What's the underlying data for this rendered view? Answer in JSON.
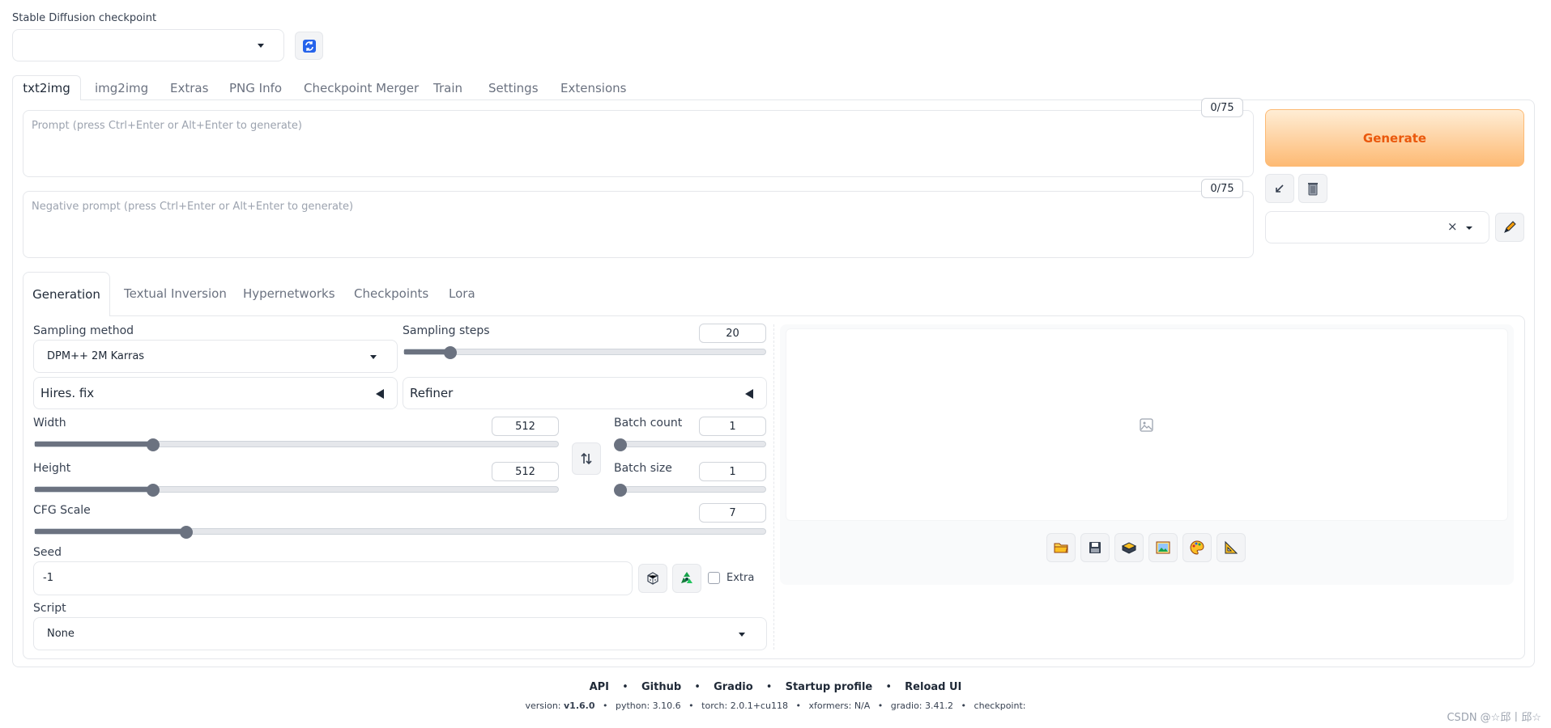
{
  "checkpoint": {
    "label": "Stable Diffusion checkpoint",
    "value": ""
  },
  "top_tabs": [
    "txt2img",
    "img2img",
    "Extras",
    "PNG Info",
    "Checkpoint Merger",
    "Train",
    "Settings",
    "Extensions"
  ],
  "prompt": {
    "placeholder": "Prompt (press Ctrl+Enter or Alt+Enter to generate)",
    "counter": "0/75"
  },
  "negative": {
    "placeholder": "Negative prompt (press Ctrl+Enter or Alt+Enter to generate)",
    "counter": "0/75"
  },
  "generate_label": "Generate",
  "styles": {
    "value": "",
    "clear": "×"
  },
  "sub_tabs": [
    "Generation",
    "Textual Inversion",
    "Hypernetworks",
    "Checkpoints",
    "Lora"
  ],
  "sampling": {
    "label": "Sampling method",
    "value": "DPM++ 2M Karras"
  },
  "steps": {
    "label": "Sampling steps",
    "value": "20",
    "min": 1,
    "max": 150
  },
  "hires": {
    "label": "Hires. fix"
  },
  "refiner": {
    "label": "Refiner"
  },
  "width": {
    "label": "Width",
    "value": "512",
    "min": 64,
    "max": 2048
  },
  "height": {
    "label": "Height",
    "value": "512",
    "min": 64,
    "max": 2048
  },
  "batch_count": {
    "label": "Batch count",
    "value": "1",
    "min": 1,
    "max": 100
  },
  "batch_size": {
    "label": "Batch size",
    "value": "1",
    "min": 1,
    "max": 8
  },
  "cfg": {
    "label": "CFG Scale",
    "value": "7",
    "min": 1,
    "max": 30
  },
  "seed": {
    "label": "Seed",
    "value": "-1",
    "extra_label": "Extra"
  },
  "script": {
    "label": "Script",
    "value": "None"
  },
  "footer": {
    "links": [
      "API",
      "Github",
      "Gradio",
      "Startup profile",
      "Reload UI"
    ],
    "sep": "•",
    "version_label": "version:",
    "version": "v1.6.0",
    "python": "python: 3.10.6",
    "torch": "torch: 2.0.1+cu118",
    "xformers": "xformers: N/A",
    "gradio": "gradio: 3.41.2",
    "checkpoint": "checkpoint:"
  },
  "watermark": "CSDN @☆邱丨邱☆",
  "colors": {
    "accent": "#ea580c",
    "generate_bg": "#fdba74"
  }
}
